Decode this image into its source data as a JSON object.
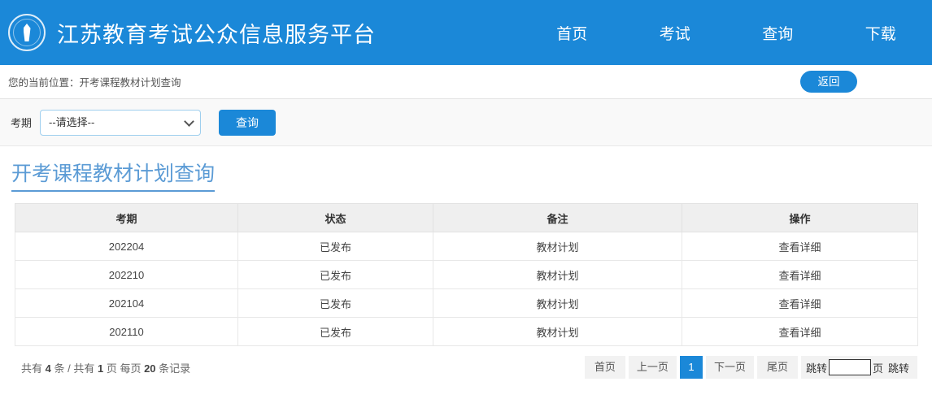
{
  "header": {
    "logo_icon": "torch-emblem-icon",
    "site_title": "江苏教育考试公众信息服务平台",
    "brand_color": "#1b88d8",
    "nav": [
      {
        "label": "首页"
      },
      {
        "label": "考试"
      },
      {
        "label": "查询"
      },
      {
        "label": "下载"
      }
    ]
  },
  "breadcrumb": {
    "text": "您的当前位置：开考课程教材计划查询",
    "back_label": "返回"
  },
  "filter": {
    "label": "考期",
    "select_value": "--请选择--",
    "select_icon": "chevron-down-icon",
    "query_label": "查询"
  },
  "main": {
    "title": "开考课程教材计划查询",
    "title_color": "#5b9bd5",
    "columns": [
      "考期",
      "状态",
      "备注",
      "操作"
    ],
    "rows": [
      {
        "term": "202204",
        "status": "已发布",
        "remark": "教材计划",
        "action": "查看详细"
      },
      {
        "term": "202210",
        "status": "已发布",
        "remark": "教材计划",
        "action": "查看详细"
      },
      {
        "term": "202104",
        "status": "已发布",
        "remark": "教材计划",
        "action": "查看详细"
      },
      {
        "term": "202110",
        "status": "已发布",
        "remark": "教材计划",
        "action": "查看详细"
      }
    ]
  },
  "footer": {
    "record_prefix": "共有",
    "total_records": "4",
    "record_mid1": "条 / 共有",
    "total_pages": "1",
    "record_mid2": "页 每页",
    "page_size": "20",
    "record_suffix": "条记录",
    "pager": {
      "first": "首页",
      "prev": "上一页",
      "current": "1",
      "next": "下一页",
      "last": "尾页",
      "jump_label": "跳转",
      "jump_value": "",
      "jump_placeholder": "",
      "page_unit": "页",
      "jump_go": "跳转"
    }
  }
}
